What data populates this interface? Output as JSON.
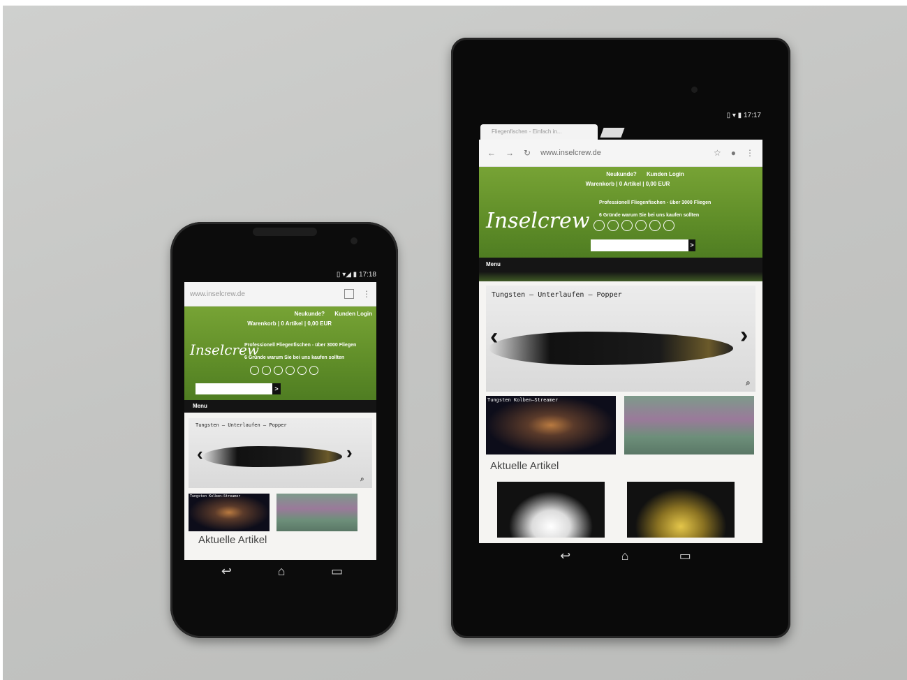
{
  "site": {
    "url": "www.inselcrew.de",
    "tab_title": "Fliegenfischen - Einfach in...",
    "header_links": [
      "Neukunde?",
      "Kunden Login"
    ],
    "cart": "Warenkorb |  0  Artikel |  0,00 EUR",
    "logo": "Inselcrew",
    "promo_line1": "Professionell Fliegenfischen - über 3000 Fliegen",
    "promo_line2": "6 Gründe warum Sie bei uns kaufen sollten",
    "search_button": ">",
    "menu_label": "Menu",
    "slide_caption": "Tungsten – Unterlaufen – Popper",
    "thumb1_caption": "Tungsten Kolben–Streamer",
    "section_title": "Aktuelle Artikel",
    "slide_prev": "‹",
    "slide_next": "›",
    "zoom_icon": "⌕"
  },
  "phone": {
    "status_time": "17:18",
    "status_icons": "▯ ▾◢ ▮"
  },
  "tablet": {
    "status_time": "17:17",
    "status_icons": "▯ ▾ ▮"
  },
  "nav_buttons": {
    "back": "↩",
    "home": "⌂",
    "recents": "▭"
  },
  "colors": {
    "site_green": "#6a9a2e",
    "device_body": "#0c0c0c",
    "background": "#c7c8c6"
  }
}
